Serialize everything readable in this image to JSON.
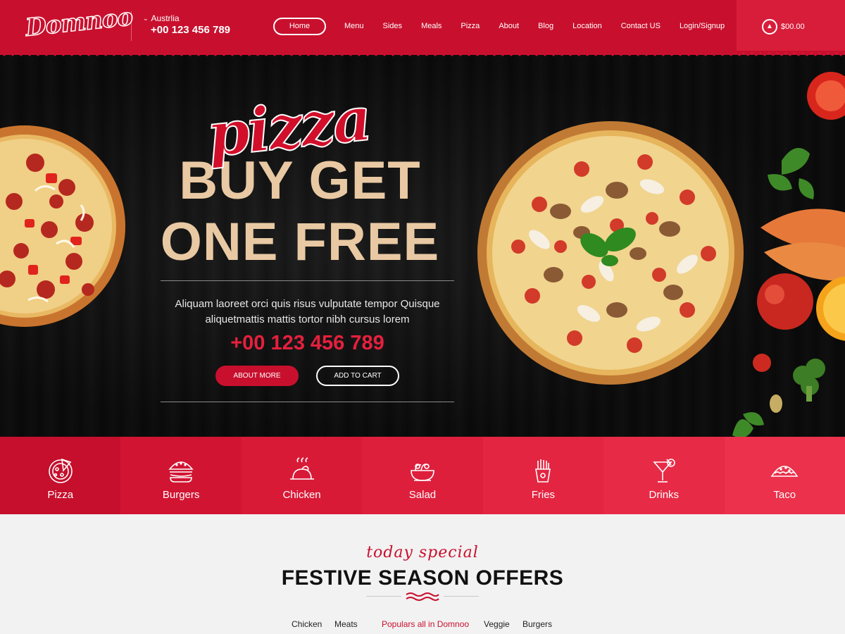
{
  "header": {
    "logo": "Domnoo",
    "country": "Austrlia",
    "phone": "+00 123 456 789",
    "nav": [
      "Home",
      "Menu",
      "Sides",
      "Meals",
      "Pizza",
      "About",
      "Blog",
      "Location",
      "Contact US",
      "Login/Signup"
    ],
    "cart_amount": "$00.00",
    "accent": "#c8102e"
  },
  "hero": {
    "script": "pizza",
    "headline_1": "BUY GET",
    "headline_2": "ONE FREE",
    "description": "Aliquam laoreet orci quis risus vulputate tempor Quisque aliquetmattis mattis tortor nibh cursus lorem",
    "phone": "+00 123 456 789",
    "btn_about": "ABOUT MORE",
    "btn_cart": "ADD TO CART"
  },
  "categories": [
    {
      "label": "Pizza",
      "icon": "pizza-icon",
      "color": "#c50f2c"
    },
    {
      "label": "Burgers",
      "icon": "burger-icon",
      "color": "#d11432"
    },
    {
      "label": "Chicken",
      "icon": "chicken-icon",
      "color": "#d81a37"
    },
    {
      "label": "Salad",
      "icon": "salad-icon",
      "color": "#de1f3c"
    },
    {
      "label": "Fries",
      "icon": "fries-icon",
      "color": "#e32541"
    },
    {
      "label": "Drinks",
      "icon": "drinks-icon",
      "color": "#e72b46"
    },
    {
      "label": "Taco",
      "icon": "taco-icon",
      "color": "#eb314b"
    }
  ],
  "special": {
    "script": "today special",
    "title": "FESTIVE SEASON OFFERS",
    "tabs": [
      "Chicken",
      "Meats",
      "Populars all in Domnoo",
      "Veggie",
      "Burgers"
    ],
    "active_tab": "Populars all in Domnoo"
  }
}
